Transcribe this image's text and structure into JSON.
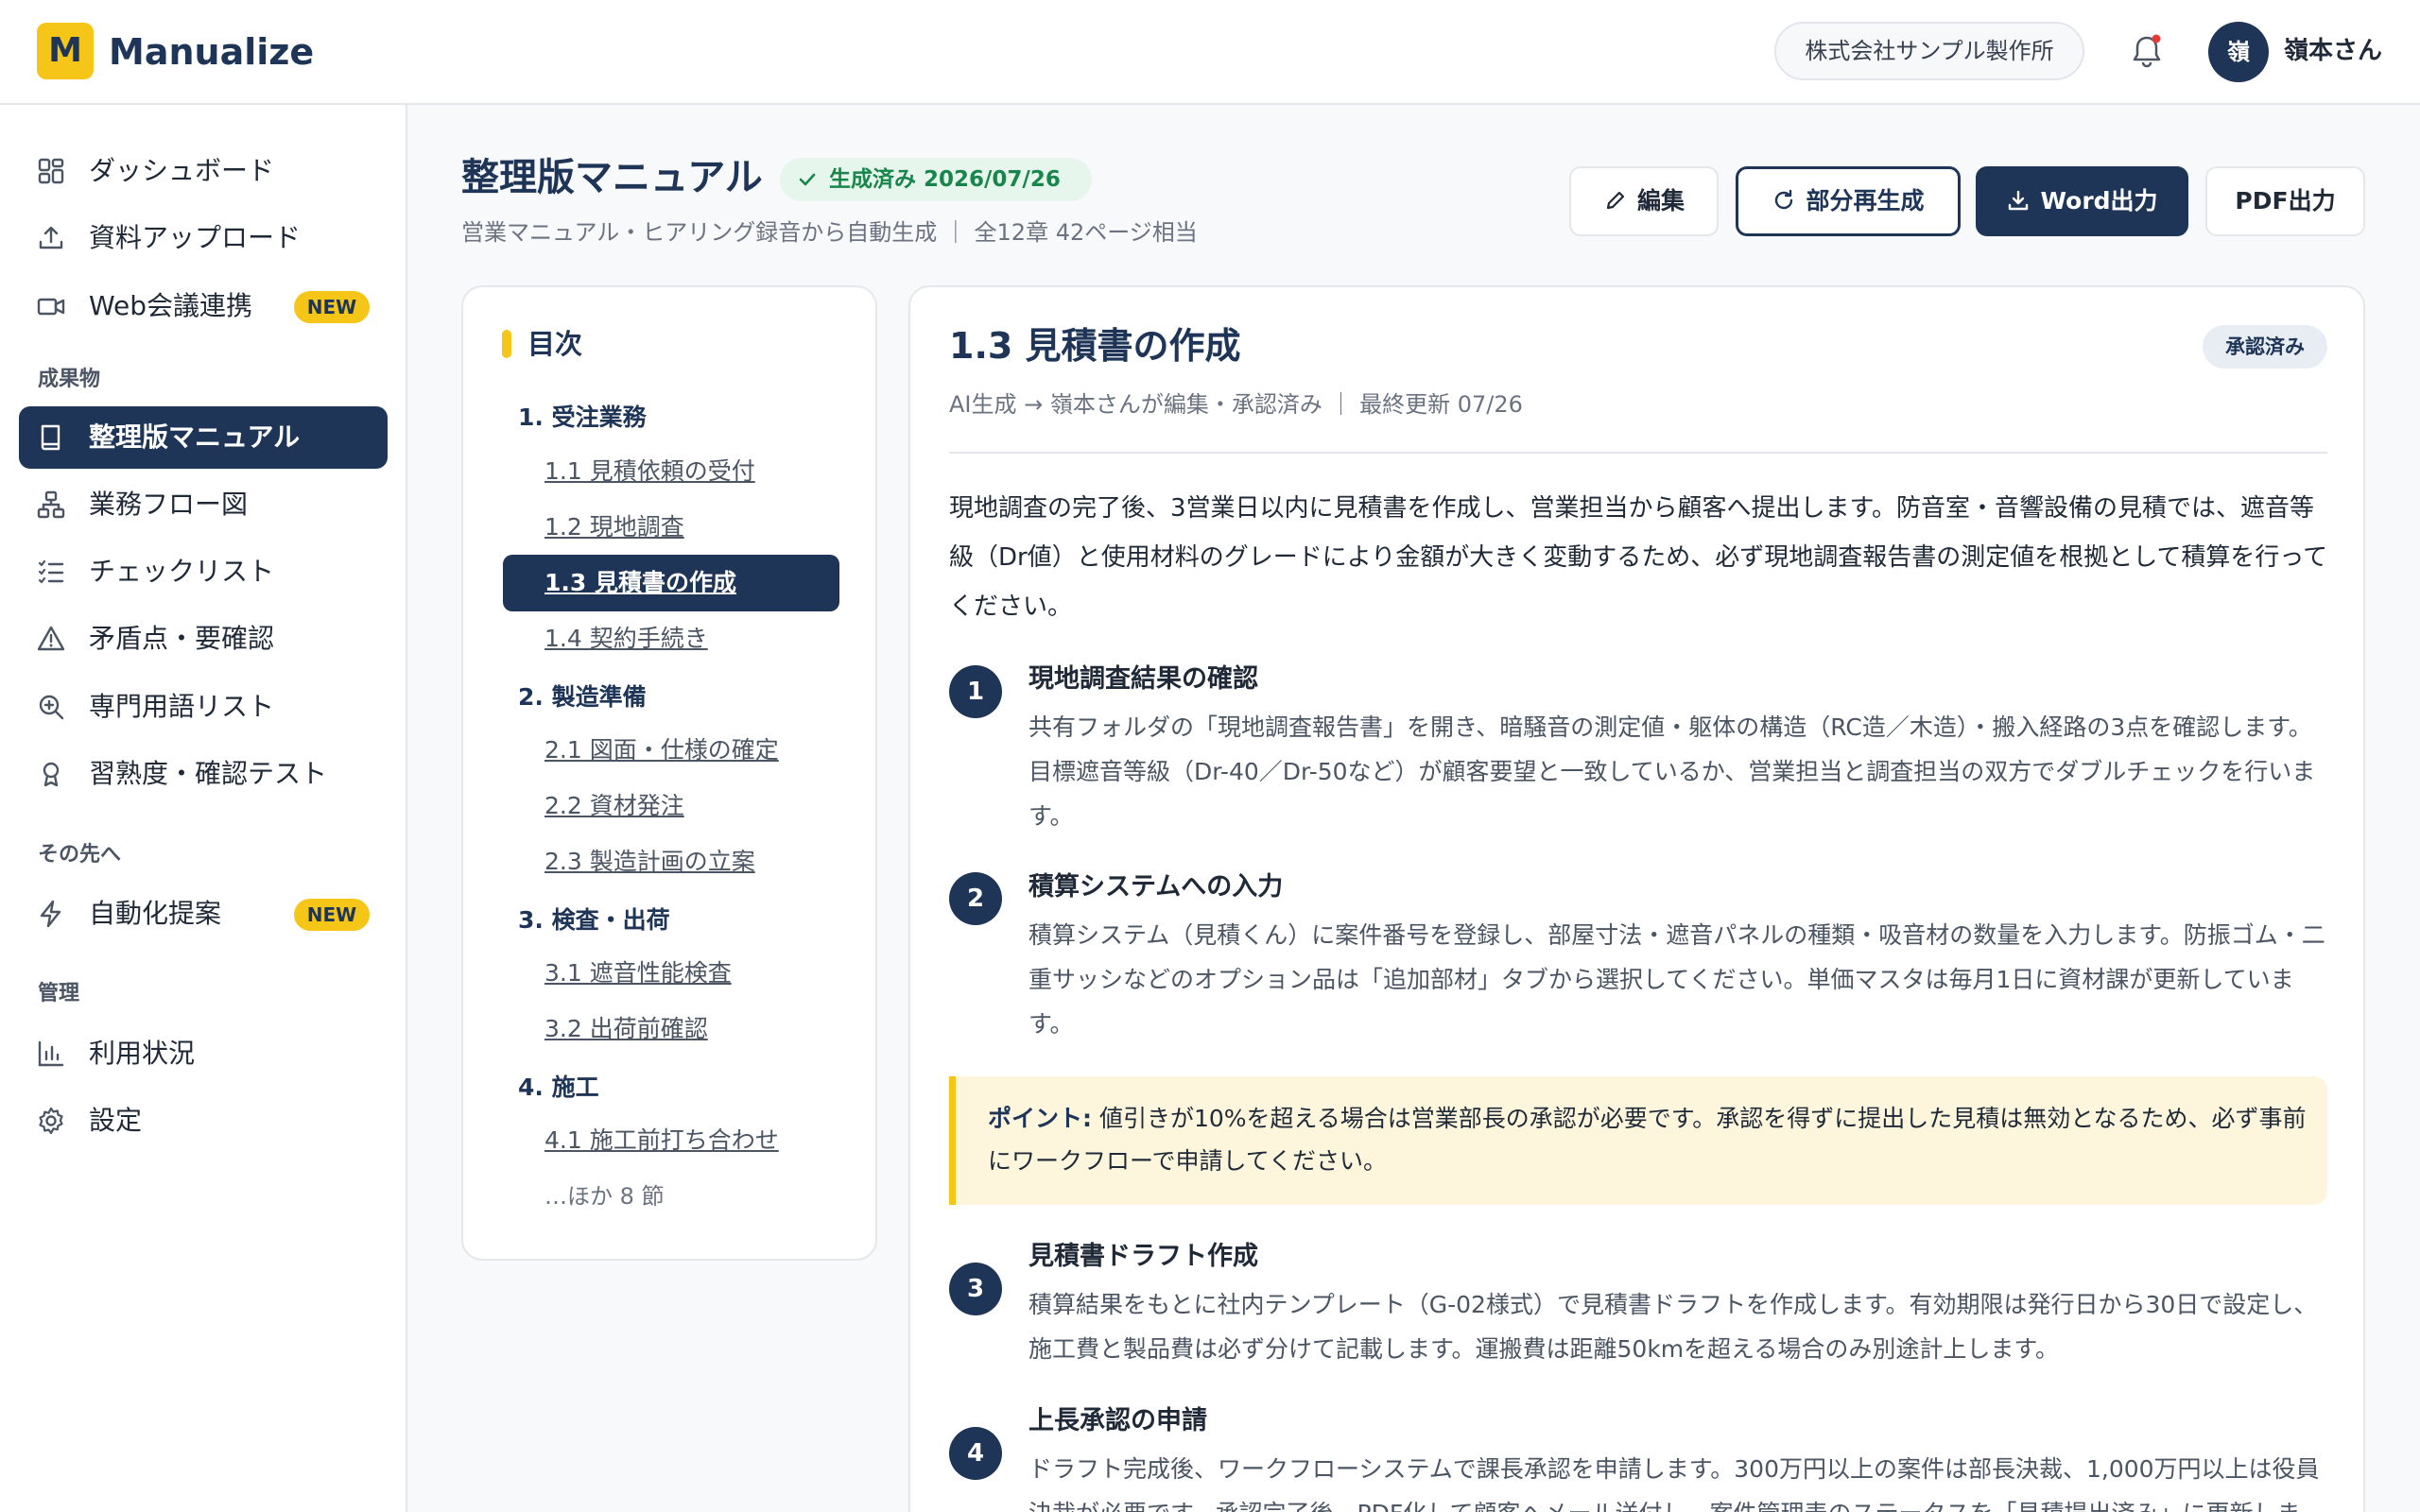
{
  "app": {
    "logo_letter": "M",
    "name": "Manualize"
  },
  "header": {
    "company": "株式会社サンプル製作所",
    "avatar_initial": "嶺",
    "user_name": "嶺本さん"
  },
  "sidebar": {
    "items_top": [
      {
        "label": "ダッシュボード",
        "icon": "dashboard-icon"
      },
      {
        "label": "資料アップロード",
        "icon": "upload-icon"
      },
      {
        "label": "Web会議連携",
        "icon": "video-icon",
        "badge": "NEW"
      }
    ],
    "section_outputs": "成果物",
    "items_outputs": [
      {
        "label": "整理版マニュアル",
        "icon": "book-icon",
        "active": true
      },
      {
        "label": "業務フロー図",
        "icon": "flow-icon"
      },
      {
        "label": "チェックリスト",
        "icon": "checklist-icon"
      },
      {
        "label": "矛盾点・要確認",
        "icon": "warning-icon"
      },
      {
        "label": "専門用語リスト",
        "icon": "search-plus-icon"
      },
      {
        "label": "習熟度・確認テスト",
        "icon": "award-icon"
      }
    ],
    "section_next": "その先へ",
    "items_next": [
      {
        "label": "自動化提案",
        "icon": "bolt-icon",
        "badge": "NEW"
      }
    ],
    "section_admin": "管理",
    "items_admin": [
      {
        "label": "利用状況",
        "icon": "chart-icon"
      },
      {
        "label": "設定",
        "icon": "gear-icon"
      }
    ]
  },
  "page": {
    "title": "整理版マニュアル",
    "status": "生成済み 2026/07/26",
    "subtitle": "営業マニュアル・ヒアリング録音から自動生成 ｜ 全12章 42ページ相当",
    "buttons": {
      "edit": "編集",
      "regen": "部分再生成",
      "word": "Word出力",
      "pdf": "PDF出力"
    }
  },
  "toc": {
    "title": "目次",
    "chapters": [
      {
        "label": "1. 受注業務",
        "sections": [
          "1.1 見積依頼の受付",
          "1.2 現地調査",
          "1.3 見積書の作成",
          "1.4 契約手続き"
        ]
      },
      {
        "label": "2. 製造準備",
        "sections": [
          "2.1 図面・仕様の確定",
          "2.2 資材発注",
          "2.3 製造計画の立案"
        ]
      },
      {
        "label": "3. 検査・出荷",
        "sections": [
          "3.1 遮音性能検査",
          "3.2 出荷前確認"
        ]
      },
      {
        "label": "4. 施工",
        "sections": [
          "4.1 施工前打ち合わせ"
        ]
      }
    ],
    "more": "…ほか 8 節"
  },
  "content": {
    "title": "1.3 見積書の作成",
    "badge": "承認済み",
    "meta": "AI生成 → 嶺本さんが編集・承認済み ｜ 最終更新 07/26",
    "intro": "現地調査の完了後、3営業日以内に見積書を作成し、営業担当から顧客へ提出します。防音室・音響設備の見積では、遮音等級（Dr値）と使用材料のグレードにより金額が大きく変動するため、必ず現地調査報告書の測定値を根拠として積算を行ってください。",
    "steps": [
      {
        "num": "1",
        "title": "現地調査結果の確認",
        "body": "共有フォルダの「現地調査報告書」を開き、暗騒音の測定値・躯体の構造（RC造／木造）・搬入経路の3点を確認します。目標遮音等級（Dr-40／Dr-50など）が顧客要望と一致しているか、営業担当と調査担当の双方でダブルチェックを行います。"
      },
      {
        "num": "2",
        "title": "積算システムへの入力",
        "body": "積算システム（見積くん）に案件番号を登録し、部屋寸法・遮音パネルの種類・吸音材の数量を入力します。防振ゴム・二重サッシなどのオプション品は「追加部材」タブから選択してください。単価マスタは毎月1日に資材課が更新しています。"
      },
      {
        "num": "3",
        "title": "見積書ドラフト作成",
        "body": "積算結果をもとに社内テンプレート（G-02様式）で見積書ドラフトを作成します。有効期限は発行日から30日で設定し、施工費と製品費は必ず分けて記載します。運搬費は距離50kmを超える場合のみ別途計上します。"
      },
      {
        "num": "4",
        "title": "上長承認の申請",
        "body": "ドラフト完成後、ワークフローシステムで課長承認を申請します。300万円以上の案件は部長決裁、1,000万円以上は役員決裁が必要です。承認完了後、PDF化して顧客へメール送付し、案件管理表のステータスを「見積提出済み」に更新します。"
      }
    ],
    "callout_label": "ポイント:",
    "callout_text": " 値引きが10%を超える場合は営業部長の承認が必要です。承認を得ずに提出した見積は無効となるため、必ず事前にワークフローで申請してください。"
  },
  "colors": {
    "primary": "#1e3557",
    "accent": "#f5c518",
    "success": "#18864b"
  }
}
